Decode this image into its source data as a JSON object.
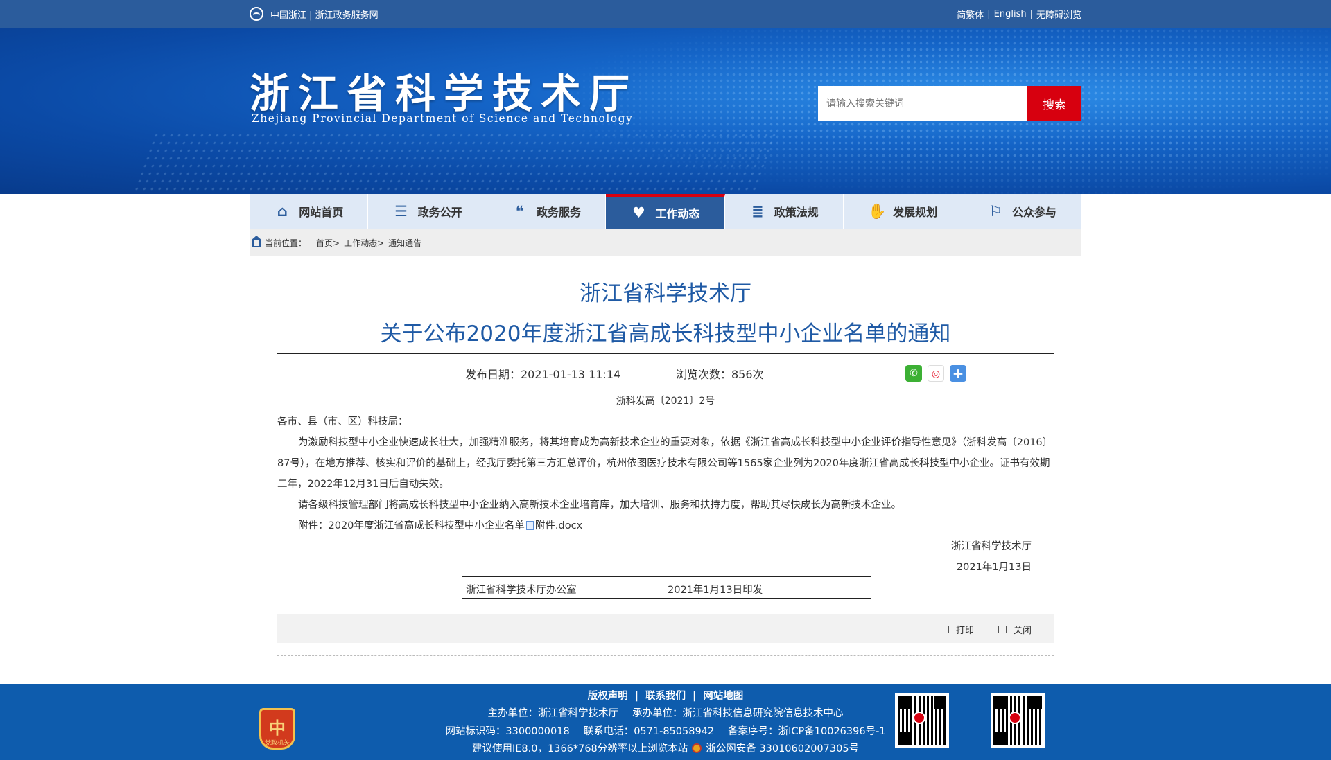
{
  "topbar": {
    "left_text": "中国浙江 | 浙江政务服务网",
    "lang_simplified_traditional": "简繁体",
    "lang_english": "English",
    "accessibility": "无障碍浏览",
    "sep": "|"
  },
  "header": {
    "title_cn": "浙江省科学技术厅",
    "title_en": "Zhejiang Provincial Department of Science and Technology",
    "search_placeholder": "请输入搜索关键词",
    "search_button": "搜索",
    "accent_color": "#d7000f",
    "brand_color": "#2b5c9c"
  },
  "nav": [
    {
      "label": "网站首页",
      "icon": "home-icon",
      "glyph": "⌂"
    },
    {
      "label": "政务公开",
      "icon": "list-icon",
      "glyph": "☰"
    },
    {
      "label": "政务服务",
      "icon": "chat-icon",
      "glyph": "❝"
    },
    {
      "label": "工作动态",
      "icon": "heart-icon",
      "glyph": "♥"
    },
    {
      "label": "政策法规",
      "icon": "document-icon",
      "glyph": "≣"
    },
    {
      "label": "发展规划",
      "icon": "handshake-icon",
      "glyph": "✋"
    },
    {
      "label": "公众参与",
      "icon": "people-icon",
      "glyph": "⚐"
    }
  ],
  "breadcrumb": {
    "prefix": "当前位置：",
    "items": [
      "首页>",
      "工作动态>",
      "通知通告"
    ]
  },
  "article": {
    "issuer": "浙江省科学技术厅",
    "title": "关于公布2020年度浙江省高成长科技型中小企业名单的通知",
    "publish_date_label": "发布日期：2021-01-13 11:14",
    "views_label": "浏览次数：856次",
    "doc_number": "浙科发高〔2021〕2号",
    "salutation": "各市、县（市、区）科技局：",
    "para1": "为激励科技型中小企业快速成长壮大，加强精准服务，将其培育成为高新技术企业的重要对象，依据《浙江省高成长科技型中小企业评价指导性意见》（浙科发高〔2016〕87号），在地方推荐、核实和评价的基础上，经我厅委托第三方汇总评价，杭州依图医疗技术有限公司等1565家企业列为2020年度浙江省高成长科技型中小企业。证书有效期二年，2022年12月31日后自动失效。",
    "para2": "请各级科技管理部门将高成长科技型中小企业纳入高新技术企业培育库，加大培训、服务和扶持力度，帮助其尽快成长为高新技术企业。",
    "attachment_prefix": "附件：2020年度浙江省高成长科技型中小企业名单",
    "attachment_file": "附件.docx",
    "signature": "浙江省科学技术厅",
    "sign_date": "2021年1月13日",
    "printed_by": "浙江省科学技术厅办公室",
    "printed_date": "2021年1月13日印发"
  },
  "share": [
    {
      "icon": "wechat-icon",
      "color": "#3cb034"
    },
    {
      "icon": "weibo-icon",
      "color": "#e6162d"
    },
    {
      "icon": "plus-share-icon",
      "color": "#4a90e2"
    }
  ],
  "toolbar": {
    "print": "打印",
    "close": "关闭"
  },
  "footer": {
    "links": [
      "版权声明",
      "联系我们",
      "网站地图"
    ],
    "host": "主办单位：浙江省科学技术厅",
    "undertaker": "承办单位：浙江省科技信息研究院信息技术中心",
    "site_id": "网站标识码：3300000018",
    "phone": "联系电话：0571-85058942",
    "icp": "备案序号：浙ICP备10026396号-1",
    "browser_tip": "建议使用IE8.0，1366*768分辨率以上浏览本站",
    "police": "浙公网安备 33010602007305号",
    "badge_text": "党政机关"
  }
}
